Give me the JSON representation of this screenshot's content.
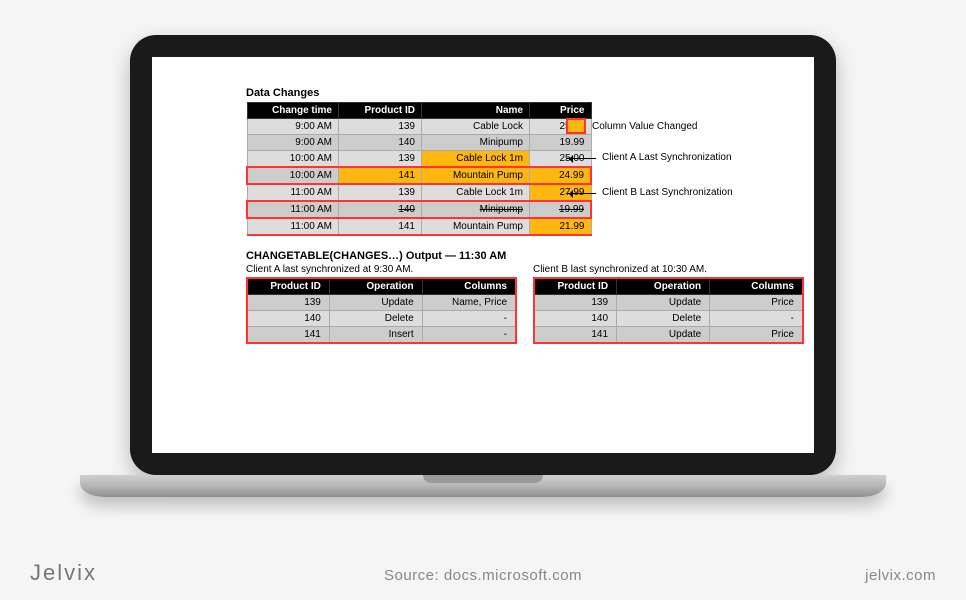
{
  "title_main": "Data Changes",
  "table1": {
    "headers": [
      "Change time",
      "Product ID",
      "Name",
      "Price"
    ],
    "rows": [
      {
        "cells": [
          "9:00 AM",
          "139",
          "Cable Lock",
          "25.00"
        ],
        "highlight": [],
        "strike": [],
        "redbox": false
      },
      {
        "cells": [
          "9:00 AM",
          "140",
          "Minipump",
          "19.99"
        ],
        "highlight": [],
        "strike": [],
        "redbox": false
      },
      {
        "cells": [
          "10:00 AM",
          "139",
          "Cable Lock 1m",
          "25.00"
        ],
        "highlight": [
          2
        ],
        "strike": [],
        "redbox": false
      },
      {
        "cells": [
          "10:00 AM",
          "141",
          "Mountain Pump",
          "24.99"
        ],
        "highlight": [
          1,
          2,
          3
        ],
        "strike": [],
        "redbox": true
      },
      {
        "cells": [
          "11:00 AM",
          "139",
          "Cable Lock 1m",
          "27.99"
        ],
        "highlight": [
          3
        ],
        "strike": [],
        "redbox": false
      },
      {
        "cells": [
          "11:00 AM",
          "140",
          "Minipump",
          "19.99"
        ],
        "highlight": [],
        "strike": [
          1,
          2,
          3
        ],
        "redbox": true
      },
      {
        "cells": [
          "11:00 AM",
          "141",
          "Mountain Pump",
          "21.99"
        ],
        "highlight": [
          3
        ],
        "strike": [],
        "redbox": false
      }
    ]
  },
  "legend": {
    "changed": "Column Value Changed",
    "clientA": "Client A Last Synchronization",
    "clientB": "Client B Last Synchronization"
  },
  "section2_title": "CHANGETABLE(CHANGES…) Output — 11:30 AM",
  "sync": {
    "headers": [
      "Product ID",
      "Operation",
      "Columns"
    ],
    "a": {
      "caption": "Client A last synchronized at 9:30 AM.",
      "rows": [
        [
          "139",
          "Update",
          "Name, Price"
        ],
        [
          "140",
          "Delete",
          "-"
        ],
        [
          "141",
          "Insert",
          "-"
        ]
      ]
    },
    "b": {
      "caption": "Client B last synchronized at 10:30 AM.",
      "rows": [
        [
          "139",
          "Update",
          "Price"
        ],
        [
          "140",
          "Delete",
          "-"
        ],
        [
          "141",
          "Update",
          "Price"
        ]
      ]
    }
  },
  "footer": {
    "brand": "Jelvix",
    "source": "Source: docs.microsoft.com",
    "site": "jelvix.com"
  }
}
